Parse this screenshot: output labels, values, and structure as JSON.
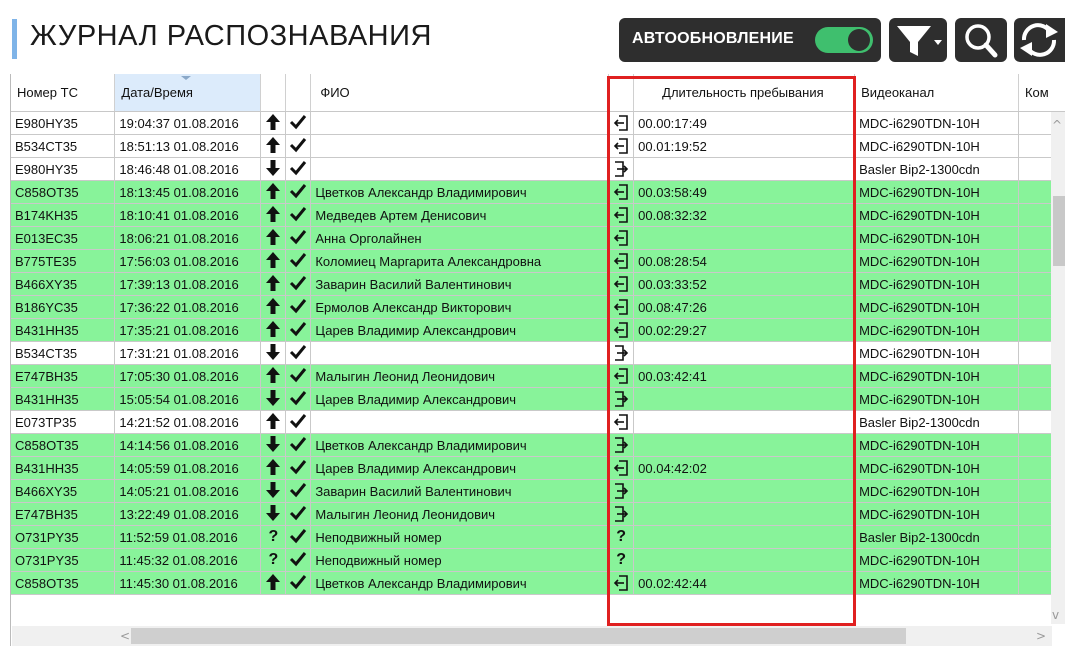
{
  "header": {
    "title": "ЖУРНАЛ РАСПОЗНАВАНИЯ",
    "auto_refresh_label": "АВТООБНОВЛЕНИЕ",
    "auto_refresh_on": true
  },
  "colors": {
    "row_green": "#88f39a",
    "highlight": "#e02020",
    "toolbar_bg": "#2e2e2e",
    "toggle_on": "#3fbf6e"
  },
  "table": {
    "columns": [
      "Номер ТС",
      "Дата/Время",
      "",
      "",
      "ФИО",
      "",
      "Длительность пребывания",
      "Видеоканал",
      "Ком"
    ],
    "rows": [
      {
        "plate": "E980HY35",
        "datetime": "19:04:37 01.08.2016",
        "dir": "up",
        "checked": true,
        "name": "",
        "entry": "in",
        "duration": "00.00:17:49",
        "channel": "MDC-i6290TDN-10H",
        "green": false
      },
      {
        "plate": "B534CT35",
        "datetime": "18:51:13 01.08.2016",
        "dir": "up",
        "checked": true,
        "name": "",
        "entry": "in",
        "duration": "00.01:19:52",
        "channel": "MDC-i6290TDN-10H",
        "green": false
      },
      {
        "plate": "E980HY35",
        "datetime": "18:46:48 01.08.2016",
        "dir": "down",
        "checked": true,
        "name": "",
        "entry": "out",
        "duration": "",
        "channel": "Basler Bip2-1300cdn",
        "green": false
      },
      {
        "plate": "C858OT35",
        "datetime": "18:13:45 01.08.2016",
        "dir": "up",
        "checked": true,
        "name": "Цветков Александр Владимирович",
        "entry": "in",
        "duration": "00.03:58:49",
        "channel": "MDC-i6290TDN-10H",
        "green": true
      },
      {
        "plate": "B174KH35",
        "datetime": "18:10:41 01.08.2016",
        "dir": "up",
        "checked": true,
        "name": "Медведев Артем Денисович",
        "entry": "in",
        "duration": "00.08:32:32",
        "channel": "MDC-i6290TDN-10H",
        "green": true
      },
      {
        "plate": "E013EC35",
        "datetime": "18:06:21 01.08.2016",
        "dir": "up",
        "checked": true,
        "name": "Анна Орголайнен",
        "entry": "in",
        "duration": "",
        "channel": "MDC-i6290TDN-10H",
        "green": true
      },
      {
        "plate": "B775TE35",
        "datetime": "17:56:03 01.08.2016",
        "dir": "up",
        "checked": true,
        "name": "Коломиец Маргарита Александровна",
        "entry": "in",
        "duration": "00.08:28:54",
        "channel": "MDC-i6290TDN-10H",
        "green": true
      },
      {
        "plate": "B466XY35",
        "datetime": "17:39:13 01.08.2016",
        "dir": "up",
        "checked": true,
        "name": "Заварин Василий Валентинович",
        "entry": "in",
        "duration": "00.03:33:52",
        "channel": "MDC-i6290TDN-10H",
        "green": true
      },
      {
        "plate": "B186YC35",
        "datetime": "17:36:22 01.08.2016",
        "dir": "up",
        "checked": true,
        "name": "Ермолов Александр Викторович",
        "entry": "in",
        "duration": "00.08:47:26",
        "channel": "MDC-i6290TDN-10H",
        "green": true
      },
      {
        "plate": "B431HH35",
        "datetime": "17:35:21 01.08.2016",
        "dir": "up",
        "checked": true,
        "name": "Царев Владимир Александрович",
        "entry": "in",
        "duration": "00.02:29:27",
        "channel": "MDC-i6290TDN-10H",
        "green": true
      },
      {
        "plate": "B534CT35",
        "datetime": "17:31:21 01.08.2016",
        "dir": "down",
        "checked": true,
        "name": "",
        "entry": "out",
        "duration": "",
        "channel": "MDC-i6290TDN-10H",
        "green": false
      },
      {
        "plate": "E747BH35",
        "datetime": "17:05:30 01.08.2016",
        "dir": "up",
        "checked": true,
        "name": "Малыгин Леонид Леонидович",
        "entry": "in",
        "duration": "00.03:42:41",
        "channel": "MDC-i6290TDN-10H",
        "green": true
      },
      {
        "plate": "B431HH35",
        "datetime": "15:05:54 01.08.2016",
        "dir": "down",
        "checked": true,
        "name": "Царев Владимир Александрович",
        "entry": "out",
        "duration": "",
        "channel": "MDC-i6290TDN-10H",
        "green": true
      },
      {
        "plate": "E073TP35",
        "datetime": "14:21:52 01.08.2016",
        "dir": "up",
        "checked": true,
        "name": "",
        "entry": "in",
        "duration": "",
        "channel": "Basler Bip2-1300cdn",
        "green": false
      },
      {
        "plate": "C858OT35",
        "datetime": "14:14:56 01.08.2016",
        "dir": "down",
        "checked": true,
        "name": "Цветков Александр Владимирович",
        "entry": "out",
        "duration": "",
        "channel": "MDC-i6290TDN-10H",
        "green": true
      },
      {
        "plate": "B431HH35",
        "datetime": "14:05:59 01.08.2016",
        "dir": "up",
        "checked": true,
        "name": "Царев Владимир Александрович",
        "entry": "in",
        "duration": "00.04:42:02",
        "channel": "MDC-i6290TDN-10H",
        "green": true
      },
      {
        "plate": "B466XY35",
        "datetime": "14:05:21 01.08.2016",
        "dir": "down",
        "checked": true,
        "name": "Заварин Василий Валентинович",
        "entry": "out",
        "duration": "",
        "channel": "MDC-i6290TDN-10H",
        "green": true
      },
      {
        "plate": "E747BH35",
        "datetime": "13:22:49 01.08.2016",
        "dir": "down",
        "checked": true,
        "name": "Малыгин Леонид Леонидович",
        "entry": "out",
        "duration": "",
        "channel": "MDC-i6290TDN-10H",
        "green": true
      },
      {
        "plate": "O731PY35",
        "datetime": "11:52:59 01.08.2016",
        "dir": "unknown",
        "checked": true,
        "name": "Неподвижный номер",
        "entry": "unknown",
        "duration": "",
        "channel": "Basler Bip2-1300cdn",
        "green": true
      },
      {
        "plate": "O731PY35",
        "datetime": "11:45:32 01.08.2016",
        "dir": "unknown",
        "checked": true,
        "name": "Неподвижный номер",
        "entry": "unknown",
        "duration": "",
        "channel": "MDC-i6290TDN-10H",
        "green": true
      },
      {
        "plate": "C858OT35",
        "datetime": "11:45:30 01.08.2016",
        "dir": "up",
        "checked": true,
        "name": "Цветков Александр Владимирович",
        "entry": "in",
        "duration": "00.02:42:44",
        "channel": "MDC-i6290TDN-10H",
        "green": true
      }
    ]
  }
}
